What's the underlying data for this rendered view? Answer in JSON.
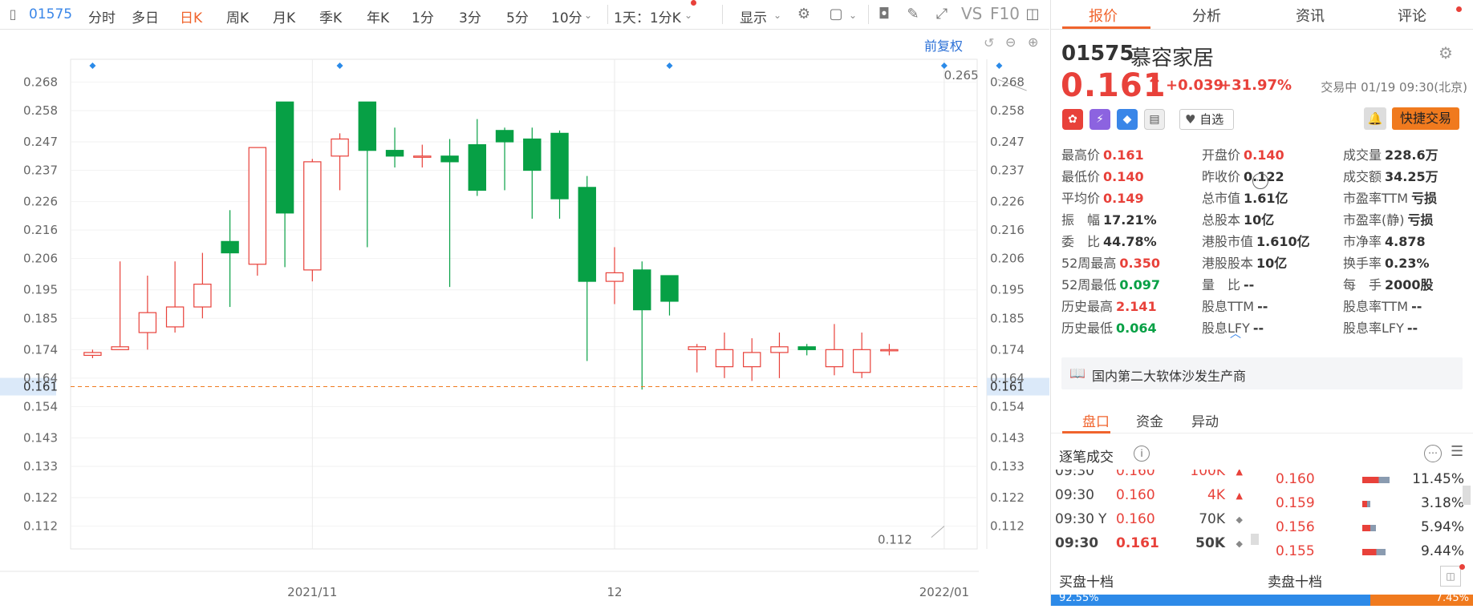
{
  "toolbar": {
    "code": "01575",
    "periods": [
      {
        "label": "分时",
        "active": false
      },
      {
        "label": "多日",
        "active": false
      },
      {
        "label": "日K",
        "active": true
      },
      {
        "label": "周K",
        "active": false
      },
      {
        "label": "月K",
        "active": false
      },
      {
        "label": "季K",
        "active": false
      },
      {
        "label": "年K",
        "active": false
      },
      {
        "label": "1分",
        "active": false
      },
      {
        "label": "3分",
        "active": false
      },
      {
        "label": "5分",
        "active": false
      },
      {
        "label": "10分",
        "active": false
      }
    ],
    "interval_select": "1天：1分K",
    "display_label": "显示",
    "vs_label": "VS",
    "f10_label": "F10",
    "pre_adjust": "前复权"
  },
  "chart_data": {
    "type": "candlestick",
    "y_ticks": [
      "0.268",
      "0.258",
      "0.247",
      "0.237",
      "0.226",
      "0.216",
      "0.206",
      "0.195",
      "0.185",
      "0.174",
      "0.164",
      "0.154",
      "0.143",
      "0.133",
      "0.122",
      "0.112"
    ],
    "ylim": [
      0.104,
      0.276
    ],
    "x_labels": [
      {
        "label": "2021/11",
        "index": 8
      },
      {
        "label": "12",
        "index": 19
      },
      {
        "label": "2022/01",
        "index": 31
      }
    ],
    "current_price": "0.161",
    "current_price_value": 0.161,
    "high_annotation": {
      "label": "0.265",
      "index": 34,
      "value": 0.265
    },
    "low_annotation": {
      "label": "0.112",
      "index": 31,
      "value": 0.112
    },
    "event_markers": [
      0,
      9,
      21,
      31,
      33,
      35,
      36
    ],
    "candles": [
      [
        0.172,
        0.173,
        0.174,
        0.171
      ],
      [
        0.174,
        0.175,
        0.205,
        0.174
      ],
      [
        0.18,
        0.187,
        0.2,
        0.174
      ],
      [
        0.182,
        0.189,
        0.205,
        0.18
      ],
      [
        0.189,
        0.197,
        0.208,
        0.185
      ],
      [
        0.212,
        0.208,
        0.223,
        0.189
      ],
      [
        0.204,
        0.245,
        0.245,
        0.2
      ],
      [
        0.261,
        0.222,
        0.261,
        0.203
      ],
      [
        0.202,
        0.24,
        0.241,
        0.198
      ],
      [
        0.242,
        0.248,
        0.25,
        0.23
      ],
      [
        0.261,
        0.244,
        0.261,
        0.21
      ],
      [
        0.244,
        0.242,
        0.252,
        0.238
      ],
      [
        0.242,
        0.242,
        0.246,
        0.238
      ],
      [
        0.242,
        0.24,
        0.248,
        0.196
      ],
      [
        0.246,
        0.23,
        0.255,
        0.228
      ],
      [
        0.251,
        0.247,
        0.252,
        0.23
      ],
      [
        0.248,
        0.237,
        0.252,
        0.22
      ],
      [
        0.25,
        0.227,
        0.251,
        0.22
      ],
      [
        0.231,
        0.198,
        0.235,
        0.17
      ],
      [
        0.198,
        0.201,
        0.21,
        0.19
      ],
      [
        0.202,
        0.188,
        0.205,
        0.16
      ],
      [
        0.2,
        0.191,
        0.2,
        0.186
      ],
      [
        0.174,
        0.175,
        0.176,
        0.166
      ],
      [
        0.168,
        0.174,
        0.18,
        0.164
      ],
      [
        0.168,
        0.173,
        0.178,
        0.163
      ],
      [
        0.173,
        0.175,
        0.18,
        0.164
      ],
      [
        0.175,
        0.174,
        0.176,
        0.172
      ],
      [
        0.168,
        0.174,
        0.183,
        0.165
      ],
      [
        0.166,
        0.174,
        0.18,
        0.164
      ],
      [
        0.174,
        0.174,
        0.176,
        0.172
      ]
    ]
  },
  "panel": {
    "tabs": [
      {
        "label": "报价",
        "active": true
      },
      {
        "label": "分析",
        "active": false
      },
      {
        "label": "资讯",
        "active": false
      },
      {
        "label": "评论",
        "active": false
      }
    ],
    "code": "01575",
    "name": "慕容家居",
    "price": "0.161",
    "arrow": "↑",
    "change": "+0.039",
    "change_pct": "+31.97%",
    "status": "交易中 01/19 09:30(北京)",
    "watch_label": "自选",
    "fast_trade": "快捷交易",
    "stats": [
      {
        "k": "最高价",
        "v": "0.161",
        "c": "red"
      },
      {
        "k": "开盘价",
        "v": "0.140",
        "c": "red"
      },
      {
        "k": "成交量",
        "v": "228.6万",
        "c": ""
      },
      {
        "k": "最低价",
        "v": "0.140",
        "c": "red"
      },
      {
        "k": "昨收价",
        "v": "0.122",
        "c": ""
      },
      {
        "k": "成交额",
        "v": "34.25万",
        "c": ""
      },
      {
        "k": "平均价",
        "v": "0.149",
        "c": "red"
      },
      {
        "k": "总市值",
        "v": "1.61亿",
        "c": ""
      },
      {
        "k": "市盈率TTM",
        "v": "亏损",
        "c": ""
      },
      {
        "k": "振　幅",
        "v": "17.21%",
        "c": ""
      },
      {
        "k": "总股本",
        "v": "10亿",
        "c": ""
      },
      {
        "k": "市盈率(静)",
        "v": "亏损",
        "c": ""
      },
      {
        "k": "委　比",
        "v": "44.78%",
        "c": ""
      },
      {
        "k": "港股市值",
        "v": "1.610亿",
        "c": ""
      },
      {
        "k": "市净率",
        "v": "4.878",
        "c": ""
      },
      {
        "k": "52周最高",
        "v": "0.350",
        "c": "red"
      },
      {
        "k": "港股股本",
        "v": "10亿",
        "c": ""
      },
      {
        "k": "换手率",
        "v": "0.23%",
        "c": ""
      },
      {
        "k": "52周最低",
        "v": "0.097",
        "c": "green"
      },
      {
        "k": "量　比",
        "v": "--",
        "c": ""
      },
      {
        "k": "每　手",
        "v": "2000股",
        "c": ""
      },
      {
        "k": "历史最高",
        "v": "2.141",
        "c": "red"
      },
      {
        "k": "股息TTM",
        "v": "--",
        "c": ""
      },
      {
        "k": "股息率TTM",
        "v": "--",
        "c": ""
      },
      {
        "k": "历史最低",
        "v": "0.064",
        "c": "green"
      },
      {
        "k": "股息LFY",
        "v": "--",
        "c": ""
      },
      {
        "k": "股息率LFY",
        "v": "--",
        "c": ""
      }
    ],
    "company_desc": "国内第二大软体沙发生产商",
    "subtabs": [
      {
        "label": "盘口",
        "active": true
      },
      {
        "label": "资金",
        "active": false
      },
      {
        "label": "异动",
        "active": false
      }
    ],
    "trades_title": "逐笔成交",
    "trades": [
      {
        "time": "09:30",
        "flag": "",
        "price": "0.160",
        "vol": "100K",
        "dir": "▲",
        "bold": false
      },
      {
        "time": "09:30",
        "flag": "",
        "price": "0.160",
        "vol": "4K",
        "dir": "▲",
        "bold": false
      },
      {
        "time": "09:30",
        "flag": "Y",
        "price": "0.160",
        "vol": "70K",
        "dir": "◆",
        "bold": false
      },
      {
        "time": "09:30",
        "flag": "",
        "price": "0.161",
        "vol": "50K",
        "dir": "◆",
        "bold": true
      }
    ],
    "book": [
      {
        "price": "0.160",
        "pct": "11.45%",
        "fill": 0.7
      },
      {
        "price": "0.159",
        "pct": "3.18%",
        "fill": 0.2
      },
      {
        "price": "0.156",
        "pct": "5.94%",
        "fill": 0.35
      },
      {
        "price": "0.155",
        "pct": "9.44%",
        "fill": 0.6
      }
    ],
    "buy_ten": "买盘十档",
    "sell_ten": "卖盘十档",
    "buy_pct": "92.55%",
    "sell_pct": "7.45%"
  }
}
